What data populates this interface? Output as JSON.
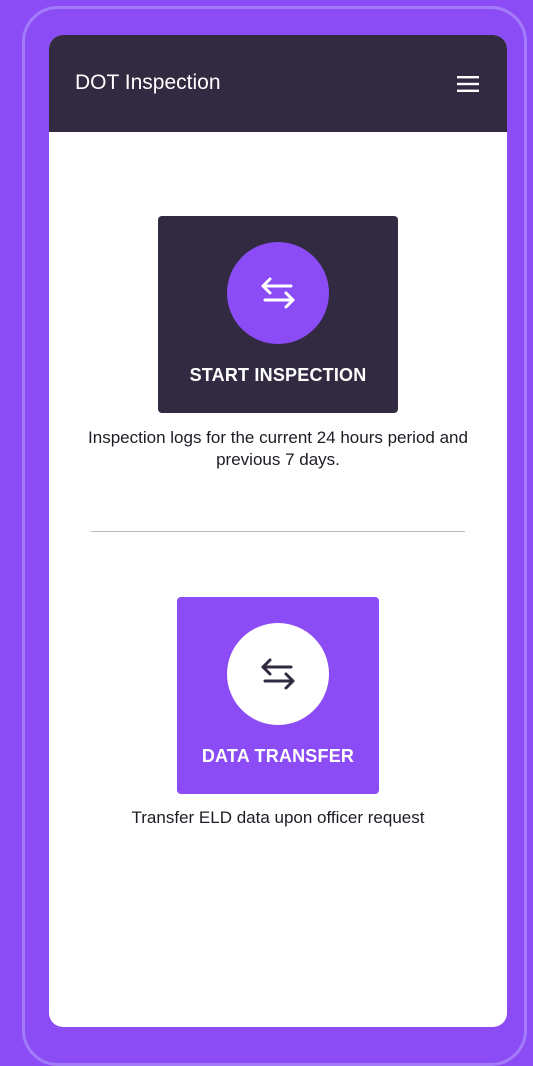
{
  "app_bar": {
    "title": "DOT Inspection",
    "menu_icon": "hamburger-menu-icon"
  },
  "actions": [
    {
      "label": "START INSPECTION",
      "description": "Inspection logs for the current 24 hours period and previous 7 days.",
      "icon": "swap-arrows-icon"
    },
    {
      "label": "DATA TRANSFER",
      "description": "Transfer ELD data upon officer request",
      "icon": "swap-arrows-icon"
    }
  ],
  "colors": {
    "accent": "#8b4cf6",
    "dark": "#322a40",
    "surface": "#ffffff"
  }
}
